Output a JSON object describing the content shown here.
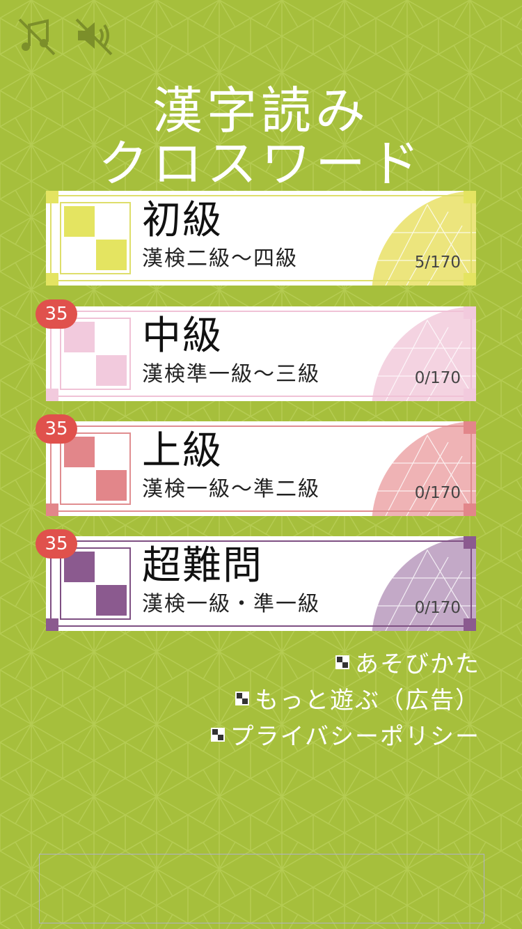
{
  "top_controls": {
    "music_icon": "music-muted-icon",
    "sound_icon": "speaker-muted-icon"
  },
  "title": {
    "line1": "漢字読み",
    "line2": "クロスワード"
  },
  "levels": [
    {
      "name": "初級",
      "range": "漢検二級〜四級",
      "progress": "5/170",
      "badge": "",
      "accent": "#e4e461",
      "border": "#dede6a",
      "deco": "#ece57d"
    },
    {
      "name": "中級",
      "range": "漢検準一級〜三級",
      "progress": "0/170",
      "badge": "35",
      "accent": "#f2cadd",
      "border": "#f0c2d6",
      "deco": "#f4d3e1"
    },
    {
      "name": "上級",
      "range": "漢検一級〜準二級",
      "progress": "0/170",
      "badge": "35",
      "accent": "#e2868a",
      "border": "#e08d90",
      "deco": "#efb3b5"
    },
    {
      "name": "超難問",
      "range": "漢検一級・準一級",
      "progress": "0/170",
      "badge": "35",
      "accent": "#8b5a8f",
      "border": "#7e4f82",
      "deco": "#c3a9c7"
    }
  ],
  "menu": {
    "how_to_play": "あそびかた",
    "more_games": "もっと遊ぶ（広告）",
    "privacy_policy": "プライバシーポリシー"
  },
  "colors": {
    "background": "#a6bf3c",
    "badge": "#e0514c"
  }
}
